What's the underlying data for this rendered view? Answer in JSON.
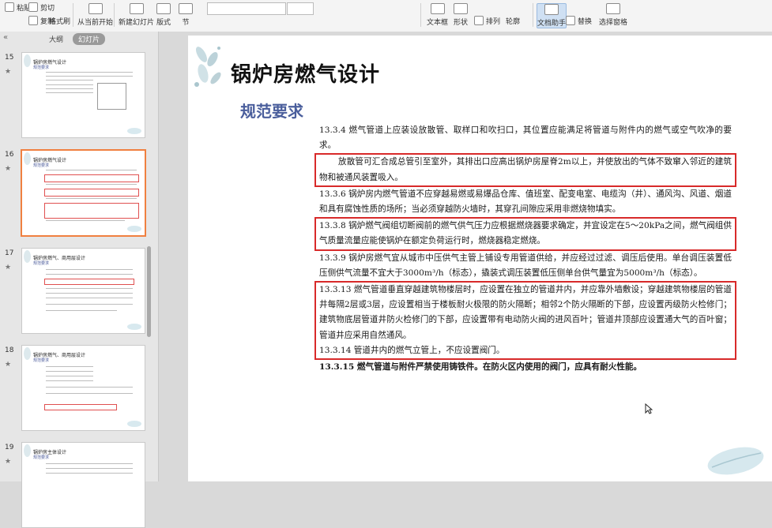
{
  "ribbon": {
    "paste_label": "粘贴",
    "cut_label": "剪切",
    "copy_label": "复制",
    "format_painter_label": "格式刷",
    "from_current_label": "从当前开始",
    "new_slide_label": "新建幻灯片",
    "layout_label": "版式",
    "section_label": "节",
    "textbox_label": "文本框",
    "shape_label": "形状",
    "arrange_label": "排列",
    "outline_label": "轮廓",
    "text_tools_label": "文档助手",
    "replace_label": "替换",
    "select_label": "选择窗格"
  },
  "panel": {
    "tab_outline": "大纲",
    "tab_slides": "幻灯片"
  },
  "thumbnails": [
    {
      "number": "15",
      "title": "锅炉房燃气设计",
      "subtitle": "规范要求"
    },
    {
      "number": "16",
      "title": "锅炉房燃气设计",
      "subtitle": "规范要求"
    },
    {
      "number": "17",
      "title": "锅炉房燃气、商用层设计",
      "subtitle": "规范要求"
    },
    {
      "number": "18",
      "title": "锅炉房燃气、商用层设计",
      "subtitle": "规范要求"
    },
    {
      "number": "19",
      "title": "锅炉房主体设计",
      "subtitle": "规范要求"
    }
  ],
  "slide": {
    "title": "锅炉房燃气设计",
    "subtitle": "规范要求",
    "p1": "13.3.4 燃气管道上应装设放散管、取样口和吹扫口，其位置应能满足将管道与附件内的燃气或空气吹净的要求。",
    "p2": "放散管可汇合成总管引至室外，其排出口应高出锅炉房屋脊2m以上，并使放出的气体不致窜入邻近的建筑物和被通风装置吸入。",
    "p3": "13.3.6 锅炉房内燃气管道不应穿越易燃或易爆品仓库、值班室、配变电室、电缆沟（井）、通风沟、风道、烟道和具有腐蚀性质的场所；当必须穿越防火墙时，其穿孔间隙应采用非燃烧物填实。",
    "p4": "13.3.8 锅炉燃气阀组切断阀前的燃气供气压力应根据燃烧器要求确定，并宜设定在5～20kPa之间，燃气阀组供气质量流量应能使锅炉在额定负荷运行时，燃烧器稳定燃烧。",
    "p5": "13.3.9 锅炉房燃气宜从城市中压供气主管上铺设专用管道供给，并应经过过滤、调压后使用。单台调压装置低压侧供气流量不宜大于3000m³/h（标态），撬装式调压装置低压侧单台供气量宜为5000m³/h（标态）。",
    "p6": "13.3.13 燃气管道垂直穿越建筑物楼层时，应设置在独立的管道井内，并应靠外墙敷设；穿越建筑物楼层的管道井每隔2层或3层，应设置相当于楼板耐火极限的防火隔断；相邻2个防火隔断的下部，应设置丙级防火检修门；建筑物底层管道井防火检修门的下部，应设置带有电动防火阀的进风百叶；管道井顶部应设置通大气的百叶窗；管道井应采用自然通风。",
    "p7": "13.3.14 管道井内的燃气立管上，不应设置阀门。",
    "p8": "13.3.15 燃气管道与附件严禁使用铸铁件。在防火区内使用的阀门，应具有耐火性能。"
  }
}
